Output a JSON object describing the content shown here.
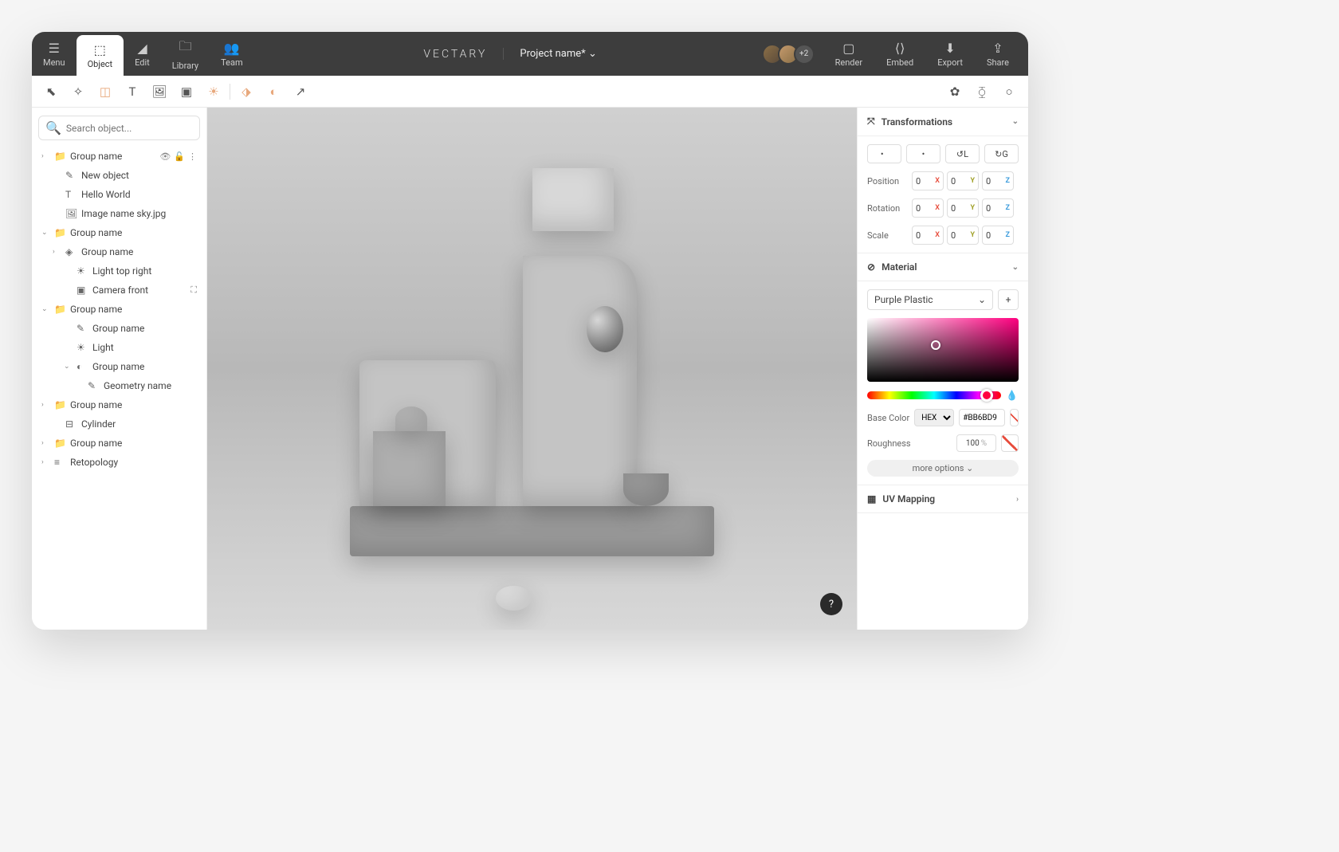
{
  "topbar": {
    "menu": "Menu",
    "object": "Object",
    "edit": "Edit",
    "library": "Library",
    "team": "Team",
    "brand": "VECTARY",
    "project": "Project name*",
    "avatar_more": "+2",
    "render": "Render",
    "embed": "Embed",
    "export": "Export",
    "share": "Share"
  },
  "search": {
    "placeholder": "Search object..."
  },
  "tree": [
    {
      "label": "Group name",
      "icon": "📁",
      "chev": "›",
      "indent": 0,
      "actions": true
    },
    {
      "label": "New object",
      "icon": "✎",
      "chev": "",
      "indent": 1
    },
    {
      "label": "Hello World",
      "icon": "T",
      "chev": "",
      "indent": 1
    },
    {
      "label": "Image name sky.jpg",
      "icon": "🖼",
      "chev": "",
      "indent": 1
    },
    {
      "label": "Group name",
      "icon": "📁",
      "chev": "⌄",
      "indent": 0
    },
    {
      "label": "Group name",
      "icon": "◈",
      "chev": "›",
      "indent": 1
    },
    {
      "label": "Light top right",
      "icon": "☀",
      "chev": "",
      "indent": 2
    },
    {
      "label": "Camera front",
      "icon": "▣",
      "chev": "",
      "indent": 2,
      "extra": "⛶"
    },
    {
      "label": "Group name",
      "icon": "📁",
      "chev": "⌄",
      "indent": 0
    },
    {
      "label": "Group name",
      "icon": "✎",
      "chev": "",
      "indent": 2
    },
    {
      "label": "Light",
      "icon": "☀",
      "chev": "",
      "indent": 2
    },
    {
      "label": "Group name",
      "icon": "◐",
      "chev": "⌄",
      "indent": 2
    },
    {
      "label": "Geometry name",
      "icon": "✎",
      "chev": "",
      "indent": 3
    },
    {
      "label": "Group name",
      "icon": "📁",
      "chev": "›",
      "indent": 0
    },
    {
      "label": "Cylinder",
      "icon": "⊟",
      "chev": "",
      "indent": 1
    },
    {
      "label": "Group name",
      "icon": "📁",
      "chev": "›",
      "indent": 0
    },
    {
      "label": "Retopology",
      "icon": "≡",
      "chev": "›",
      "indent": 0
    }
  ],
  "help": "?",
  "transforms": {
    "title": "Transformations",
    "position": {
      "label": "Position",
      "x": "0",
      "y": "0",
      "z": "0"
    },
    "rotation": {
      "label": "Rotation",
      "x": "0",
      "y": "0",
      "z": "0"
    },
    "scale": {
      "label": "Scale",
      "x": "0",
      "y": "0",
      "z": "0"
    },
    "pivot_local": "↺L",
    "pivot_global": "↻G"
  },
  "material": {
    "title": "Material",
    "selected": "Purple Plastic",
    "basecolor_label": "Base Color",
    "format": "HEX",
    "value": "#BB6BD9",
    "roughness_label": "Roughness",
    "roughness_value": "100",
    "roughness_unit": "%",
    "more": "more options"
  },
  "uv": {
    "title": "UV Mapping"
  }
}
